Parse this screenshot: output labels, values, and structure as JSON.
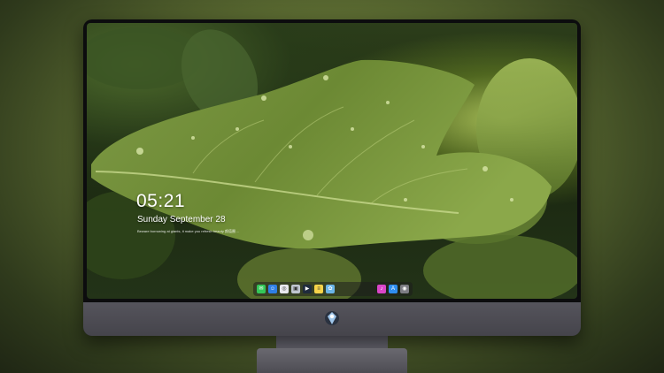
{
  "lockscreen": {
    "time": "05:21",
    "date": "Sunday September 28",
    "tagline": "Beware borrowing at giants, it make you refresh beauty 颜值圈 ..."
  },
  "dock": {
    "apps": [
      {
        "name": "messages-icon",
        "color": "#34c759",
        "glyph": "✉"
      },
      {
        "name": "finder-icon",
        "color": "#2f7fe6",
        "glyph": "☺"
      },
      {
        "name": "safari-icon",
        "color": "#e9e9ee",
        "glyph": "◎"
      },
      {
        "name": "preview-icon",
        "color": "#c0c6d0",
        "glyph": "▣"
      },
      {
        "name": "final-cut-icon",
        "color": "#1f2b3c",
        "glyph": "▶"
      },
      {
        "name": "notes-icon",
        "color": "#f7d44a",
        "glyph": "≡"
      },
      {
        "name": "photos-icon",
        "color": "#6bb5e8",
        "glyph": "✿"
      },
      {
        "name": "music-icon",
        "color": "#d946c8",
        "glyph": "♪"
      },
      {
        "name": "app-store-icon",
        "color": "#2f8ef0",
        "glyph": "A"
      },
      {
        "name": "camera-icon",
        "color": "#7d7d84",
        "glyph": "◉"
      }
    ]
  },
  "colors": {
    "leaf": "#6e8a35",
    "leaf_highlight": "#9db556",
    "monitor_chin": "#4c4b52"
  }
}
